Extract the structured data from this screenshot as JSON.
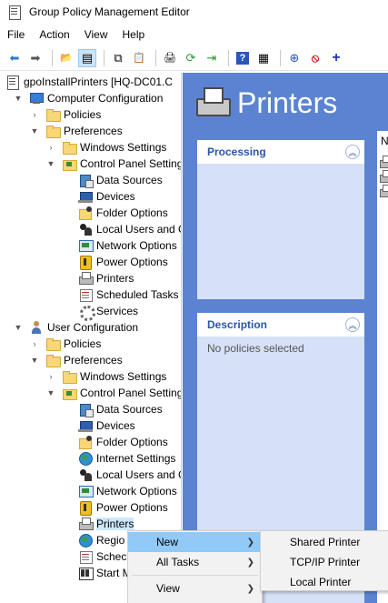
{
  "window": {
    "title": "Group Policy Management Editor"
  },
  "menubar": {
    "items": [
      "File",
      "Action",
      "View",
      "Help"
    ]
  },
  "toolbar": {
    "buttons": [
      {
        "icon": "back-arrow-icon",
        "glyph": "⬅"
      },
      {
        "icon": "forward-arrow-icon",
        "glyph": "➡"
      },
      {
        "icon": "up-folder-icon",
        "glyph": "📂"
      },
      {
        "icon": "show-hide-tree-icon",
        "glyph": "▤"
      },
      {
        "icon": "copy-icon",
        "glyph": "⧉"
      },
      {
        "icon": "paste-icon",
        "glyph": "📋"
      },
      {
        "icon": "print-icon",
        "glyph": "🖨"
      },
      {
        "icon": "refresh-icon",
        "glyph": "⟳"
      },
      {
        "icon": "export-list-icon",
        "glyph": "⇥"
      },
      {
        "icon": "help-icon",
        "glyph": "?"
      },
      {
        "icon": "properties-icon",
        "glyph": "▦"
      },
      {
        "icon": "new-item-icon",
        "glyph": "⊕"
      },
      {
        "icon": "stop-icon",
        "glyph": "⦸"
      },
      {
        "icon": "add-icon",
        "glyph": "+"
      }
    ]
  },
  "tree": {
    "root": "gpoInstallPrinters [HQ-DC01.C",
    "computer": {
      "label": "Computer Configuration",
      "policies": "Policies",
      "preferences": "Preferences",
      "windows_settings": "Windows Settings",
      "control_panel": "Control Panel Setting",
      "items": [
        "Data Sources",
        "Devices",
        "Folder Options",
        "Local Users and G",
        "Network Options",
        "Power Options",
        "Printers",
        "Scheduled Tasks",
        "Services"
      ]
    },
    "user": {
      "label": "User Configuration",
      "policies": "Policies",
      "preferences": "Preferences",
      "windows_settings": "Windows Settings",
      "control_panel": "Control Panel Setting",
      "items": [
        "Data Sources",
        "Devices",
        "Folder Options",
        "Internet Settings",
        "Local Users and G",
        "Network Options",
        "Power Options",
        "Printers",
        "Regio",
        "Schec",
        "Start M"
      ]
    }
  },
  "content": {
    "title": "Printers",
    "processing": {
      "title": "Processing"
    },
    "description": {
      "title": "Description",
      "text": "No policies selected"
    },
    "list_header": "N"
  },
  "context_menu": {
    "items": [
      {
        "label": "New",
        "submenu": true,
        "highlighted": true
      },
      {
        "label": "All Tasks",
        "submenu": true
      },
      {
        "label": "View",
        "submenu": true
      }
    ]
  },
  "submenu": {
    "items": [
      "Shared Printer",
      "TCP/IP Printer",
      "Local Printer"
    ]
  }
}
